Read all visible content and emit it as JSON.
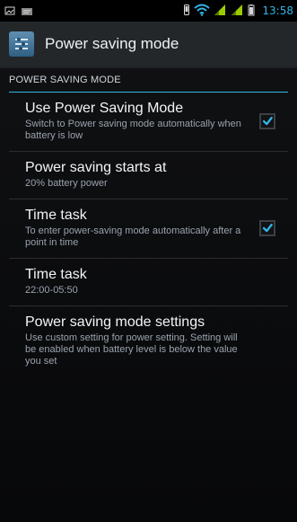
{
  "status_bar": {
    "time": "13:58",
    "icons": {
      "left_1": "screenshot-icon",
      "left_2": "message-icon",
      "right_1": "vibrate-icon",
      "right_2": "wifi-icon",
      "right_3": "signal-icon",
      "right_4": "signal-icon",
      "right_5": "battery-icon"
    }
  },
  "action_bar": {
    "icon": "power-saving-icon",
    "title": "Power saving mode"
  },
  "section": {
    "header": "POWER SAVING MODE"
  },
  "preferences": [
    {
      "title": "Use Power Saving Mode",
      "summary": "Switch to Power saving mode automatically when battery is low",
      "checked": true
    },
    {
      "title": "Power saving starts at",
      "summary": "20% battery power"
    },
    {
      "title": "Time task",
      "summary": "To enter power-saving mode automatically after a point in time",
      "checked": true
    },
    {
      "title": "Time task",
      "summary": "22:00-05:50"
    },
    {
      "title": "Power saving mode settings",
      "summary": "Use custom setting for power setting. Setting will be enabled when battery level is below the value you set"
    }
  ],
  "colors": {
    "accent": "#33b5e5",
    "status_icon_green": "#99cc00",
    "background": "#0b0c0e"
  }
}
